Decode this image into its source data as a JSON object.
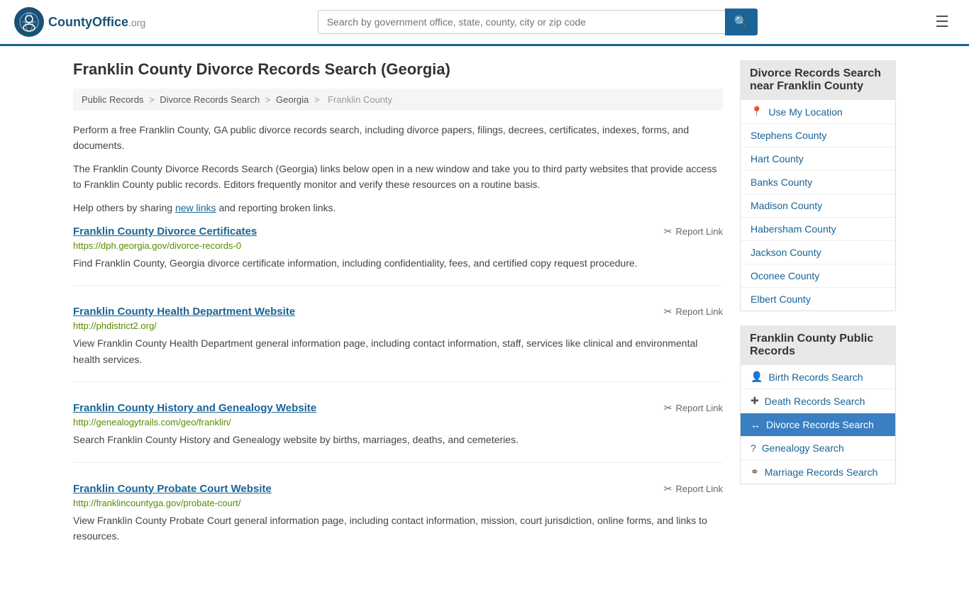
{
  "header": {
    "logo_text": "CountyOffice",
    "logo_suffix": ".org",
    "search_placeholder": "Search by government office, state, county, city or zip code",
    "search_value": ""
  },
  "page": {
    "title": "Franklin County Divorce Records Search (Georgia)",
    "breadcrumb": [
      {
        "label": "Public Records",
        "href": "#"
      },
      {
        "label": "Divorce Records Search",
        "href": "#"
      },
      {
        "label": "Georgia",
        "href": "#"
      },
      {
        "label": "Franklin County",
        "href": "#",
        "current": true
      }
    ],
    "description_1": "Perform a free Franklin County, GA public divorce records search, including divorce papers, filings, decrees, certificates, indexes, forms, and documents.",
    "description_2": "The Franklin County Divorce Records Search (Georgia) links below open in a new window and take you to third party websites that provide access to Franklin County public records. Editors frequently monitor and verify these resources on a routine basis.",
    "description_3_pre": "Help others by sharing ",
    "description_3_link": "new links",
    "description_3_post": " and reporting broken links."
  },
  "results": [
    {
      "title": "Franklin County Divorce Certificates",
      "url": "https://dph.georgia.gov/divorce-records-0",
      "desc": "Find Franklin County, Georgia divorce certificate information, including confidentiality, fees, and certified copy request procedure.",
      "report_label": "Report Link"
    },
    {
      "title": "Franklin County Health Department Website",
      "url": "http://phdistrict2.org/",
      "desc": "View Franklin County Health Department general information page, including contact information, staff, services like clinical and environmental health services.",
      "report_label": "Report Link"
    },
    {
      "title": "Franklin County History and Genealogy Website",
      "url": "http://genealogytrails.com/geo/franklin/",
      "desc": "Search Franklin County History and Genealogy website by births, marriages, deaths, and cemeteries.",
      "report_label": "Report Link"
    },
    {
      "title": "Franklin County Probate Court Website",
      "url": "http://franklincountyga.gov/probate-court/",
      "desc": "View Franklin County Probate Court general information page, including contact information, mission, court jurisdiction, online forms, and links to resources.",
      "report_label": "Report Link"
    }
  ],
  "sidebar": {
    "nearby_section": {
      "header": "Divorce Records Search near Franklin County",
      "location_label": "Use My Location",
      "counties": [
        "Stephens County",
        "Hart County",
        "Banks County",
        "Madison County",
        "Habersham County",
        "Jackson County",
        "Oconee County",
        "Elbert County"
      ]
    },
    "records_section": {
      "header": "Franklin County Public Records",
      "items": [
        {
          "label": "Birth Records Search",
          "icon": "👤",
          "active": false
        },
        {
          "label": "Death Records Search",
          "icon": "+",
          "active": false
        },
        {
          "label": "Divorce Records Search",
          "icon": "↔",
          "active": true
        },
        {
          "label": "Genealogy Search",
          "icon": "?",
          "active": false
        },
        {
          "label": "Marriage Records Search",
          "icon": "⚭",
          "active": false
        }
      ]
    }
  }
}
